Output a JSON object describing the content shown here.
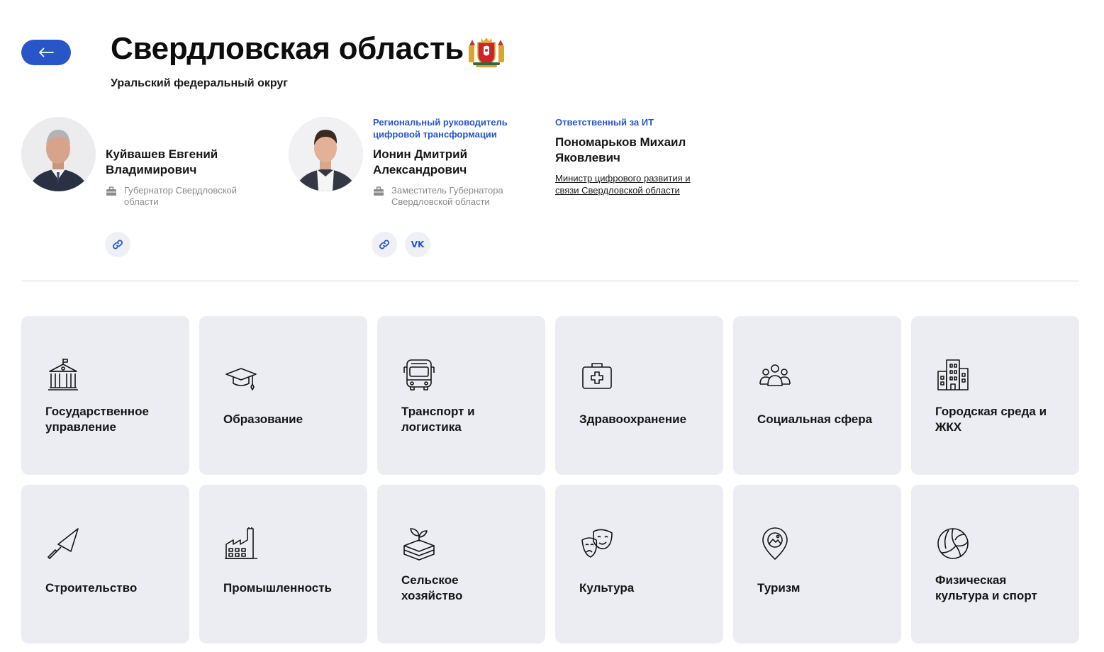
{
  "header": {
    "back_icon": "arrow-left-icon",
    "title": "Свердловская область",
    "coat_of_arms": "coat-of-arms-icon",
    "district": "Уральский федеральный округ"
  },
  "people": [
    {
      "name_line1": "Куйвашев Евгений",
      "name_line2": "Владимирович",
      "job_line1": "Губернатор Свердловской",
      "job_line2": "области",
      "socials": [
        "link-icon"
      ]
    },
    {
      "role_line1": "Региональный руководитель",
      "role_line2": "цифровой трансформации",
      "name_line1": "Ионин Дмитрий",
      "name_line2": "Александрович",
      "job_line1": "Заместитель Губернатора",
      "job_line2": "Свердловской области",
      "socials": [
        "link-icon",
        "vk-icon"
      ],
      "vk_label": "VK"
    },
    {
      "role_line1": "Ответственный за ИТ",
      "name_line1": "Пономарьков Михаил",
      "name_line2": "Яковлевич",
      "link_line1": "Министр цифрового развития и",
      "link_line2": "связи Свердловской области"
    }
  ],
  "colors": {
    "accent": "#2855c8",
    "tile_bg": "#ecedf2",
    "muted_text": "#8a8a8f"
  },
  "sectors": [
    {
      "line1": "Государственное",
      "line2": "управление",
      "icon": "government-building-icon"
    },
    {
      "line1": "Образование",
      "line2": "",
      "icon": "graduation-cap-icon"
    },
    {
      "line1": "Транспорт и",
      "line2": "логистика",
      "icon": "bus-icon"
    },
    {
      "line1": "Здравоохранение",
      "line2": "",
      "icon": "medical-kit-icon"
    },
    {
      "line1": "Социальная сфера",
      "line2": "",
      "icon": "people-group-icon"
    },
    {
      "line1": "Городская среда и",
      "line2": "ЖКХ",
      "icon": "city-buildings-icon"
    },
    {
      "line1": "Строительство",
      "line2": "",
      "icon": "trowel-icon"
    },
    {
      "line1": "Промышленность",
      "line2": "",
      "icon": "factory-icon"
    },
    {
      "line1": "Сельское",
      "line2": "хозяйство",
      "icon": "sprout-icon"
    },
    {
      "line1": "Культура",
      "line2": "",
      "icon": "theater-masks-icon"
    },
    {
      "line1": "Туризм",
      "line2": "",
      "icon": "map-pin-icon"
    },
    {
      "line1": "Физическая",
      "line2": "культура и спорт",
      "icon": "volleyball-icon"
    }
  ]
}
